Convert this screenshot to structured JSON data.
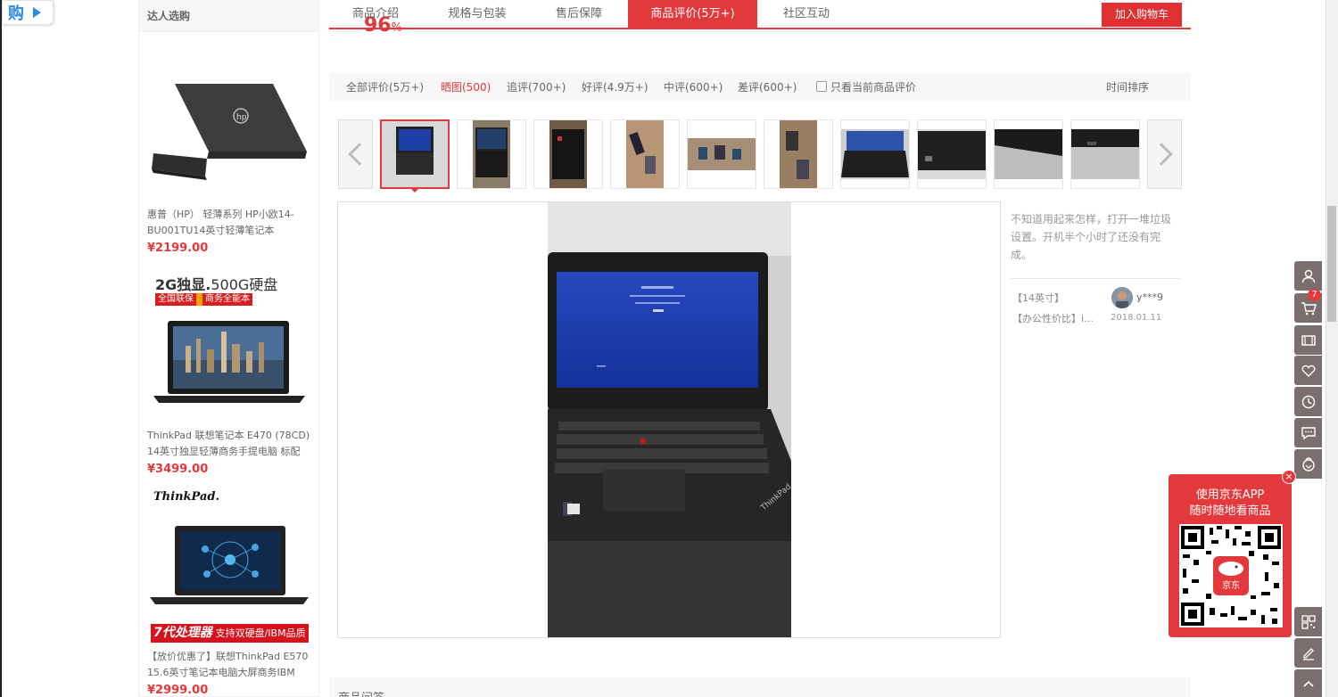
{
  "shop_badge": {
    "text": "购"
  },
  "left_column": {
    "title": "达人选购",
    "products": [
      {
        "name": "惠普（HP） 轻薄系列 HP小欧14-BU001TU14英寸轻薄笔记本",
        "price": "¥2199.00"
      },
      {
        "name": "ThinkPad 联想笔记本 E470 (78CD) 14英寸独显轻薄商务手提电脑 标配",
        "price": "¥3499.00"
      },
      {
        "name": "【放价优惠了】联想ThinkPad E570 15.6英寸笔记本电脑大屏商务IBM",
        "price": "¥2999.00"
      }
    ],
    "promo1": {
      "headline_bold": "2G独显.",
      "headline_rest": "500G硬盘",
      "tag1": "全国联保",
      "tag2": "商务全能本"
    },
    "promo2": {
      "brand": "ThinkPad.",
      "banner_bold": "7代处理器",
      "banner_rest": "支持双硬盘/IBM品质"
    }
  },
  "tabs": [
    {
      "label": "商品介绍"
    },
    {
      "label": "规格与包装"
    },
    {
      "label": "售后保障"
    },
    {
      "label": "商品评价(5万+)"
    },
    {
      "label": "社区互动"
    }
  ],
  "add_cart_label": "加入购物车",
  "rating_fragment": "%",
  "filters": [
    {
      "label": "全部评价(5万+)"
    },
    {
      "label": "晒图(500)"
    },
    {
      "label": "追评(700+)"
    },
    {
      "label": "好评(4.9万+)"
    },
    {
      "label": "中评(600+)"
    },
    {
      "label": "差评(600+)"
    }
  ],
  "only_current_label": "只看当前商品评价",
  "sort_label": "时间排序",
  "comment": {
    "text": "不知道用起来怎样，打开一堆垃圾设置。开机半个小时了还没有完成。",
    "spec1": "【14英寸】",
    "spec2": "【办公性价比】i…",
    "user": "y***9",
    "date": "2018.01.11"
  },
  "qa_title": "商品问答",
  "toolbar": {
    "cart_count": "7"
  },
  "app_promo": {
    "line1": "使用京东APP",
    "line2": "随时随地看商品",
    "logo_text": "京东"
  },
  "colors": {
    "accent": "#e4393c",
    "toolbar_bg": "#7a6e6e",
    "link_blue": "#2b8be6"
  }
}
